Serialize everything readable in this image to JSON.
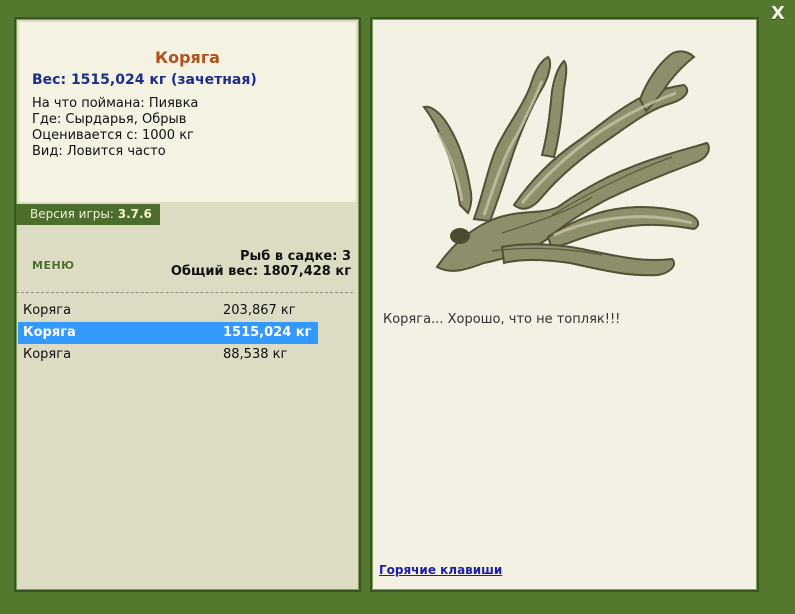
{
  "fish": {
    "name": "Коряга",
    "weight_line": "Вес: 1515,024 кг (зачетная)",
    "caught_on": "На что поймана: Пиявка",
    "where": "Где: Сырдарья, Обрыв",
    "valued_from": "Оценивается с: 1000 кг",
    "kind": "Вид: Ловится часто",
    "comment": "Коряга... Хорошо, что не топляк!!!"
  },
  "version": {
    "label": "Версия игры:",
    "value": "3.7.6"
  },
  "menu": {
    "label": "МЕНЮ"
  },
  "keeper": {
    "count_line": "Рыб в садке: 3",
    "total_line": "Общий вес: 1807,428 кг",
    "rows": [
      {
        "name": "Коряга",
        "weight": "203,867 кг",
        "selected": false
      },
      {
        "name": "Коряга",
        "weight": "1515,024 кг",
        "selected": true
      },
      {
        "name": "Коряга",
        "weight": "88,538 кг",
        "selected": false
      }
    ]
  },
  "links": {
    "hotkeys": "Горячие клавиши"
  },
  "controls": {
    "close": "X"
  },
  "colors": {
    "background": "#55782f",
    "panel": "#dbdcc3",
    "selected_row": "#3399ff",
    "title": "#b4501c"
  }
}
